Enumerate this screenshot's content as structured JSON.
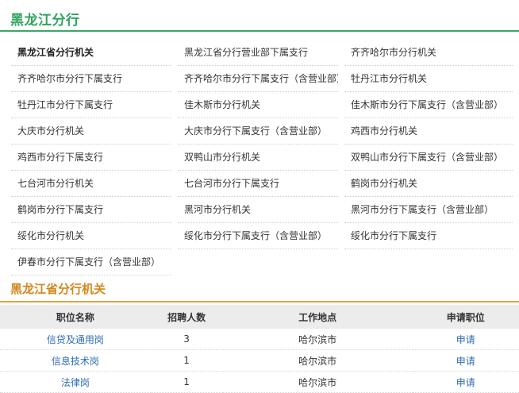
{
  "section": {
    "title": "黑龙江分行"
  },
  "branches": [
    "黑龙江省分行机关",
    "黑龙江省分行营业部下属支行",
    "齐齐哈尔市分行机关",
    "齐齐哈尔市分行下属支行",
    "齐齐哈尔市分行下属支行（含营业部）",
    "牡丹江市分行机关",
    "牡丹江市分行下属支行",
    "佳木斯市分行机关",
    "佳木斯市分行下属支行（含营业部）",
    "大庆市分行机关",
    "大庆市分行下属支行（含营业部）",
    "鸡西市分行机关",
    "鸡西市分行下属支行",
    "双鸭山市分行机关",
    "双鸭山市分行下属支行（含营业部）",
    "七台河市分行机关",
    "七台河市分行下属支行",
    "鹤岗市分行机关",
    "鹤岗市分行下属支行",
    "黑河市分行机关",
    "黑河市分行下属支行（含营业部）",
    "绥化市分行机关",
    "绥化市分行下属支行（含营业部）",
    "绥化市分行下属支行",
    "伊春市分行下属支行（含营业部）"
  ],
  "detail": {
    "title": "黑龙江省分行机关"
  },
  "table": {
    "headers": [
      "职位名称",
      "招聘人数",
      "工作地点",
      "申请职位"
    ],
    "rows": [
      {
        "name": "信贷及通用岗",
        "count": "3",
        "location": "哈尔滨市",
        "apply": "申请"
      },
      {
        "name": "信息技术岗",
        "count": "1",
        "location": "哈尔滨市",
        "apply": "申请"
      },
      {
        "name": "法律岗",
        "count": "1",
        "location": "哈尔滨市",
        "apply": "申请"
      }
    ]
  }
}
